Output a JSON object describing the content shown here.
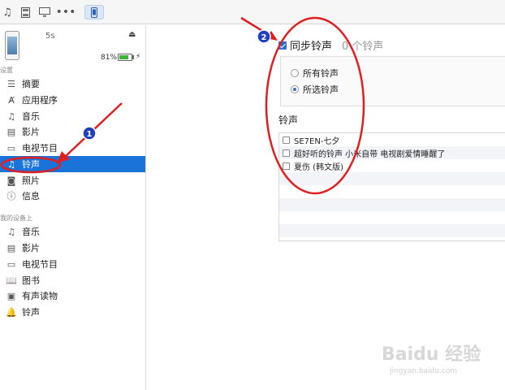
{
  "device": {
    "name": "5s",
    "battery_percent": "81%",
    "battery_level": 0.81
  },
  "sidebar": {
    "settings_title": "设置",
    "settings_items": [
      {
        "label": "摘要",
        "icon": "list-icon"
      },
      {
        "label": "应用程序",
        "icon": "app-store-icon"
      },
      {
        "label": "音乐",
        "icon": "music-note-icon"
      },
      {
        "label": "影片",
        "icon": "film-icon"
      },
      {
        "label": "电视节目",
        "icon": "tv-icon"
      },
      {
        "label": "铃声",
        "icon": "bell-icon",
        "selected": true
      },
      {
        "label": "照片",
        "icon": "camera-icon"
      },
      {
        "label": "信息",
        "icon": "info-icon"
      }
    ],
    "ondevice_title": "我的设备上",
    "ondevice_items": [
      {
        "label": "音乐",
        "icon": "music-note-icon"
      },
      {
        "label": "影片",
        "icon": "film-icon"
      },
      {
        "label": "电视节目",
        "icon": "tv-icon"
      },
      {
        "label": "图书",
        "icon": "book-icon"
      },
      {
        "label": "有声读物",
        "icon": "audiobook-icon"
      },
      {
        "label": "铃声",
        "icon": "bell-icon"
      }
    ]
  },
  "main": {
    "sync_label": "同步铃声",
    "sync_count": "0 个铃声",
    "sync_checked": true,
    "radio_all": "所有铃声",
    "radio_selected": "所选铃声",
    "ringtones_heading": "铃声",
    "ringtones": [
      "SE7EN-七夕",
      "超好听的铃声  小米自带  电视剧爱情睡醒了",
      "夏伤 (韩文版)"
    ]
  },
  "annotations": {
    "marker_1": "1",
    "marker_2": "2"
  },
  "watermark": {
    "brand": "Baidu 经验",
    "url": "jingyan.baidu.com"
  },
  "colors": {
    "selection": "#1a73d9",
    "annotation": "#e02020",
    "marker": "#1f3fbf"
  }
}
